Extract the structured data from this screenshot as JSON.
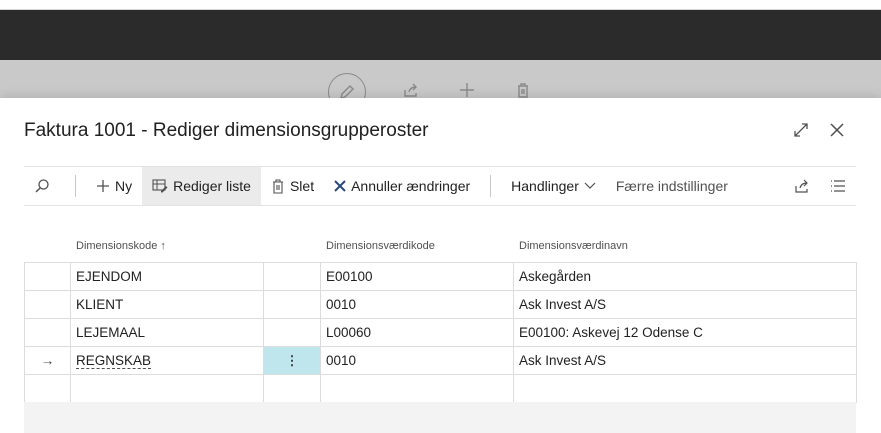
{
  "background_toolbar": {
    "icons": [
      "edit-icon",
      "share-icon",
      "plus-icon",
      "delete-icon"
    ]
  },
  "dialog": {
    "title": "Faktura 1001 - Rediger dimensionsgrupperoster",
    "expand_icon": "expand-icon",
    "close_icon": "close-icon"
  },
  "toolbar": {
    "search_icon": "search-icon",
    "new_label": "Ny",
    "edit_list_label": "Rediger liste",
    "delete_label": "Slet",
    "cancel_changes_label": "Annuller ændringer",
    "actions_label": "Handlinger",
    "fewer_options_label": "Færre indstillinger"
  },
  "columns": {
    "dim_code": "Dimensionskode ↑",
    "dim_value_code": "Dimensionsværdikode",
    "dim_value_name": "Dimensionsværdinavn"
  },
  "rows": [
    {
      "indicator": "",
      "dim_code": "EJENDOM",
      "action": "",
      "value_code": "E00100",
      "value_name": "Askegården"
    },
    {
      "indicator": "",
      "dim_code": "KLIENT",
      "action": "",
      "value_code": "0010",
      "value_name": "Ask Invest A/S"
    },
    {
      "indicator": "",
      "dim_code": "LEJEMAAL",
      "action": "",
      "value_code": "L00060",
      "value_name": "E00100: Askevej 12 Odense C"
    },
    {
      "indicator": "→",
      "dim_code": "REGNSKAB",
      "action": "⋮",
      "value_code": "0010",
      "value_name": "Ask Invest A/S"
    },
    {
      "indicator": "",
      "dim_code": "",
      "action": "",
      "value_code": "",
      "value_name": ""
    }
  ],
  "colors": {
    "selected_cell": "#bfe6ec",
    "header_bar": "#2b2b2b",
    "active_button": "#ebebeb"
  }
}
